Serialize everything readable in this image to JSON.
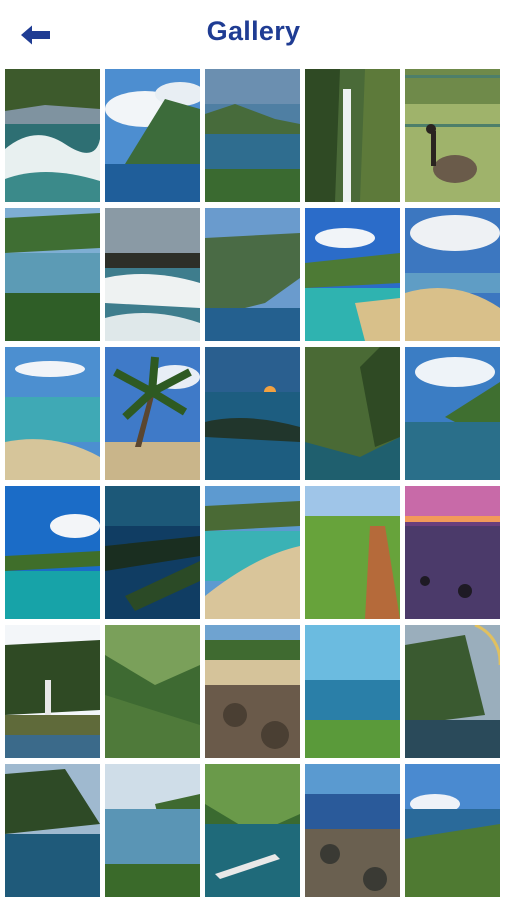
{
  "header": {
    "title": "Gallery",
    "back_icon": "arrow-left-icon",
    "accent_color": "#1f3c93"
  },
  "gallery": {
    "photos": [
      {
        "scene": "wave-cliff"
      },
      {
        "scene": "cloud-cliff"
      },
      {
        "scene": "islet-coast"
      },
      {
        "scene": "waterfall"
      },
      {
        "scene": "goose"
      },
      {
        "scene": "lagoon-trees"
      },
      {
        "scene": "surf-wave"
      },
      {
        "scene": "sea-cliffs"
      },
      {
        "scene": "turquoise-bay"
      },
      {
        "scene": "sand-beach"
      },
      {
        "scene": "shallow-beach"
      },
      {
        "scene": "palm-tree"
      },
      {
        "scene": "sunset-reef"
      },
      {
        "scene": "green-cliffs"
      },
      {
        "scene": "aerial-coast"
      },
      {
        "scene": "blue-islet"
      },
      {
        "scene": "reef-aerial"
      },
      {
        "scene": "curved-beach"
      },
      {
        "scene": "grass-path"
      },
      {
        "scene": "purple-sunset"
      },
      {
        "scene": "lighthouse"
      },
      {
        "scene": "valley-ridge"
      },
      {
        "scene": "rocky-shore"
      },
      {
        "scene": "ocean-horizon"
      },
      {
        "scene": "rainbow-cliff"
      },
      {
        "scene": "dark-cliffs"
      },
      {
        "scene": "cliff-bay"
      },
      {
        "scene": "seaplane"
      },
      {
        "scene": "tide-pools"
      },
      {
        "scene": "coast-village"
      }
    ]
  }
}
